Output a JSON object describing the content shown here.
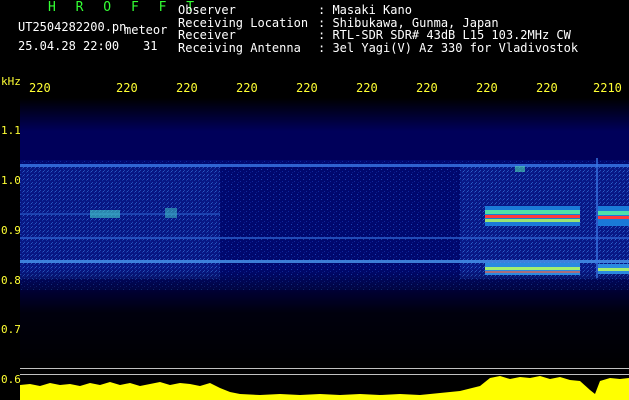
{
  "header": {
    "title": "H R O F F T",
    "filename": "UT2504282200.pn",
    "meteor_label": "meteor",
    "datetime": "25.04.28 22:00",
    "meteor_count": "31",
    "fields": [
      {
        "label": "Observer",
        "value": ": Masaki Kano"
      },
      {
        "label": "Receiving Location",
        "value": ": Shibukawa, Gunma, Japan"
      },
      {
        "label": "Receiver",
        "value": ": RTL-SDR SDR# 43dB L15 103.2MHz CW"
      },
      {
        "label": "Receiving Antenna",
        "value": ": 3el Yagi(V) Az 330 for Vladivostok"
      }
    ]
  },
  "axis": {
    "unit_label": "kHz",
    "time_ticks": [
      "220",
      "220",
      "220",
      "220",
      "220",
      "220",
      "220",
      "220",
      "220",
      "2210"
    ],
    "freq_ticks": [
      "1.1",
      "1.0",
      "0.9",
      "0.8",
      "0.7",
      "0.6"
    ]
  },
  "colors": {
    "header_title": "#33ff33",
    "axis_text": "#ffff33",
    "background": "#000000",
    "spectrogram_base": "#000066",
    "power_trace": "#ffff00"
  }
}
